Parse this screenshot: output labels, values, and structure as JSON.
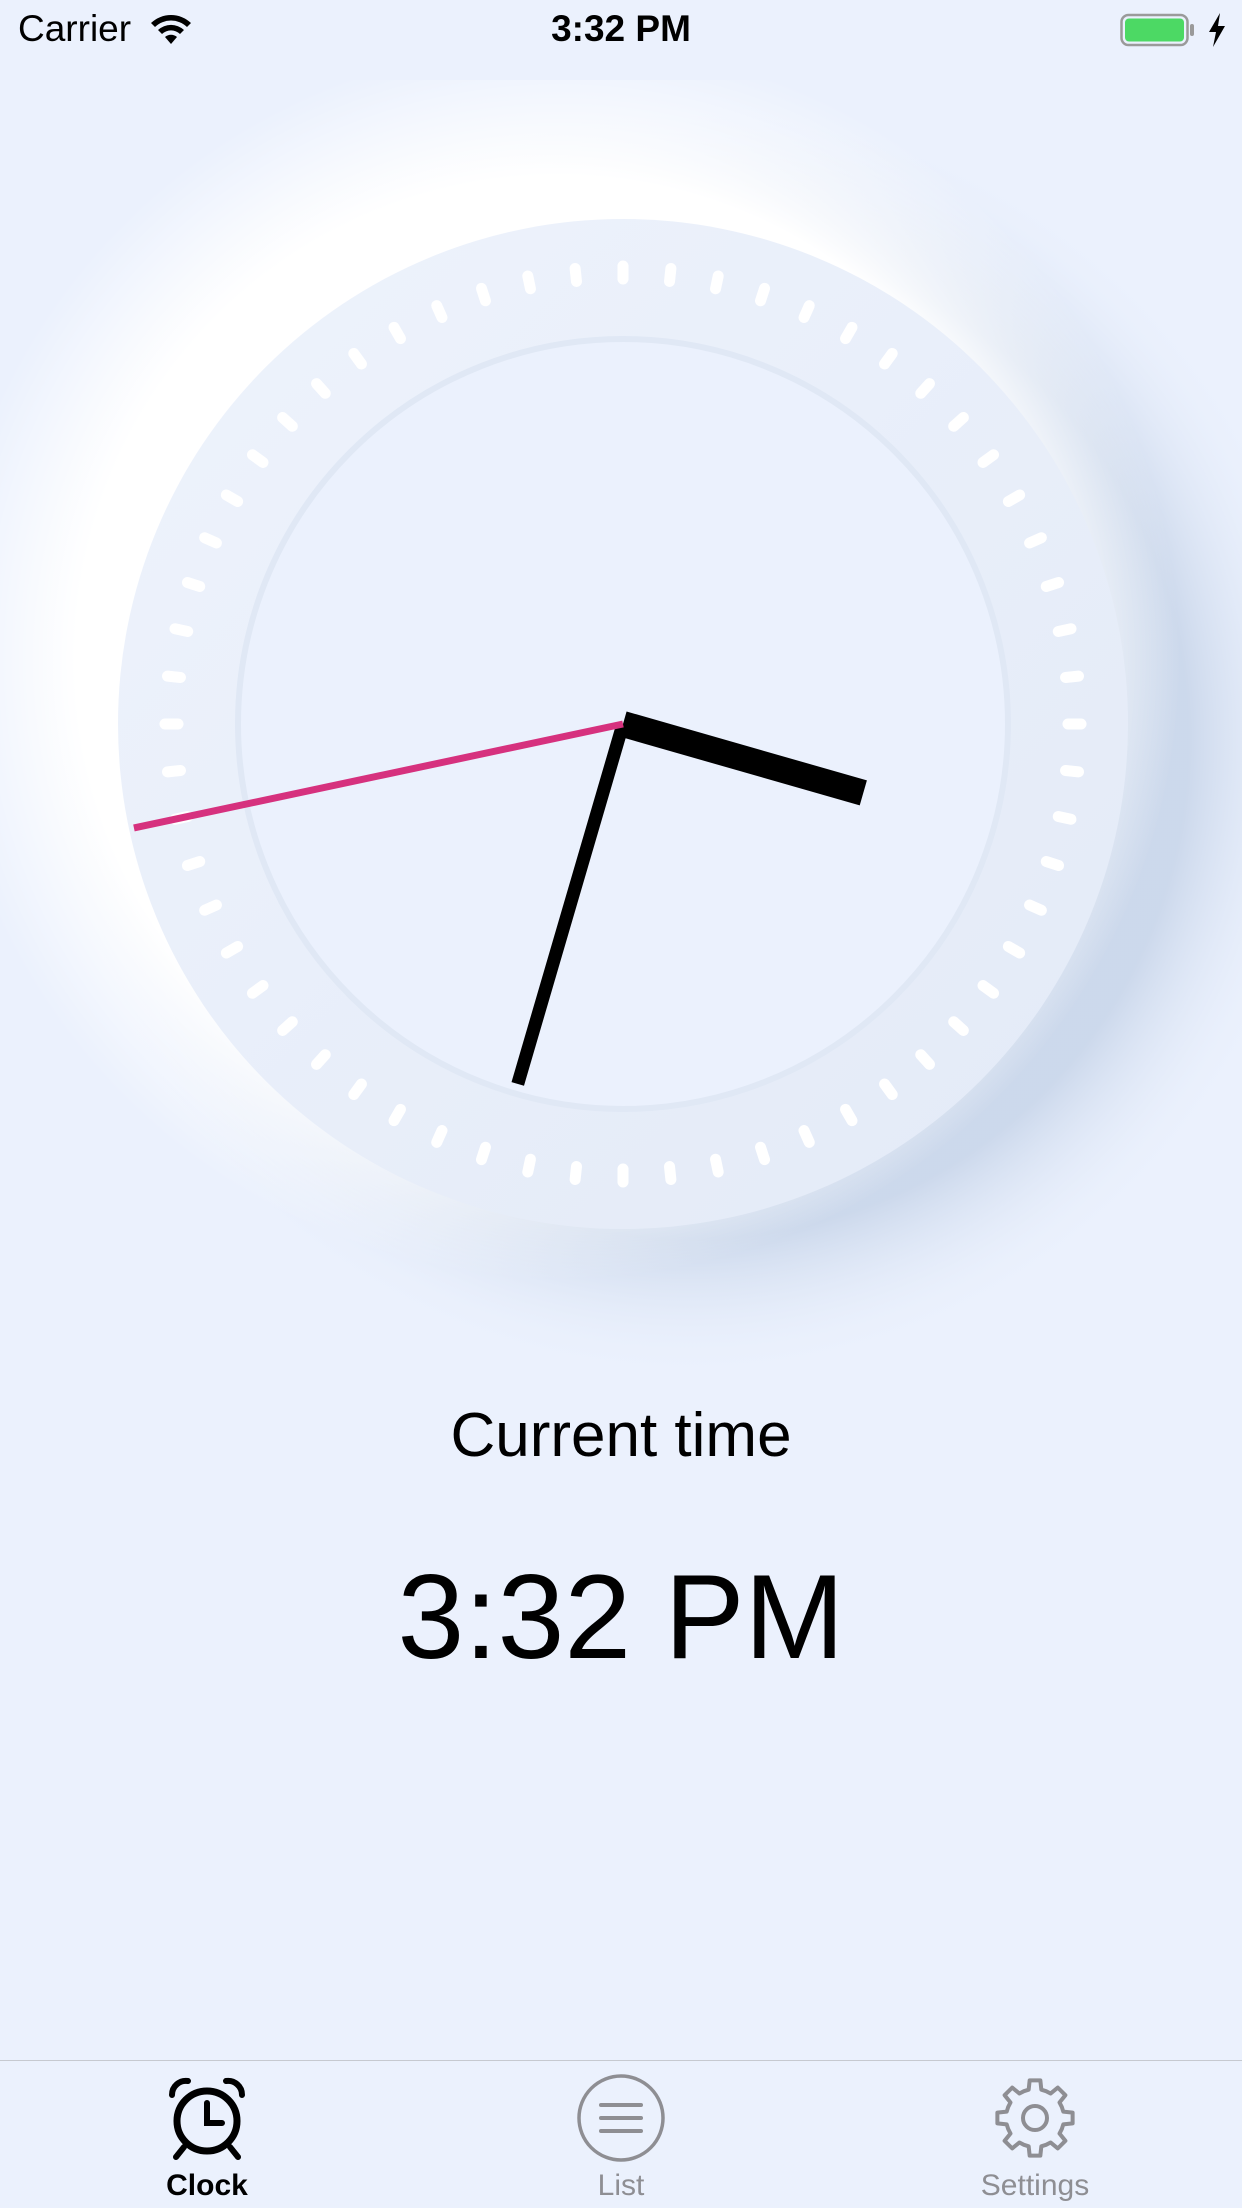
{
  "status_bar": {
    "carrier": "Carrier",
    "time": "3:32 PM",
    "wifi_icon": "wifi-icon",
    "battery_icon": "battery-icon",
    "charging_icon": "bolt-icon",
    "battery_level": 1.0
  },
  "clock": {
    "hour": 15,
    "minute": 32,
    "second": 43,
    "tick_count": 60,
    "colors": {
      "hands": "#000000",
      "second_hand": "#d6317e",
      "ticks": "#ffffff"
    }
  },
  "main": {
    "caption": "Current time",
    "time": "3:32 PM"
  },
  "tab_bar": {
    "tabs": [
      {
        "label": "Clock",
        "icon": "alarm-clock-icon",
        "active": true
      },
      {
        "label": "List",
        "icon": "list-icon",
        "active": false
      },
      {
        "label": "Settings",
        "icon": "gear-icon",
        "active": false
      }
    ]
  }
}
